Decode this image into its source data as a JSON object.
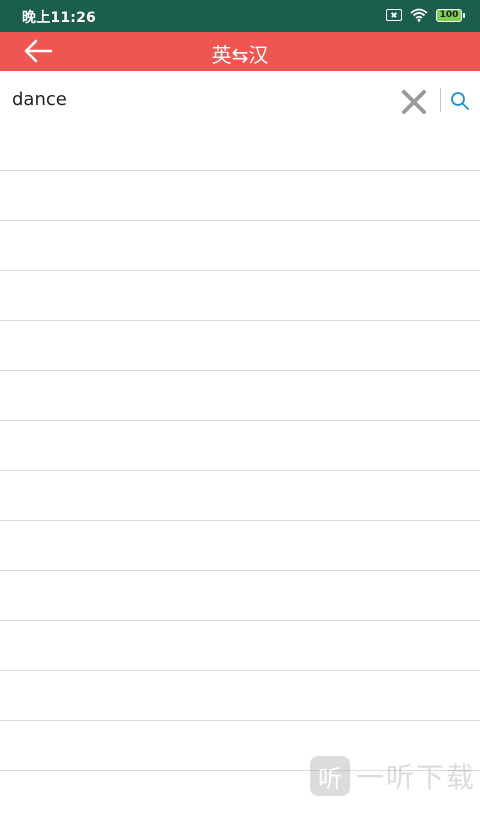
{
  "status_bar": {
    "time": "晚上11:26",
    "battery": "100",
    "icons": [
      "sim-x-icon",
      "wifi-icon",
      "battery-icon"
    ]
  },
  "app_bar": {
    "title": "英⇆汉",
    "back_icon": "arrow-left-icon",
    "background": "#ef5551"
  },
  "search": {
    "value": "dance",
    "clear_icon": "close-icon",
    "search_icon": "search-icon",
    "accent": "#1d8fd1"
  },
  "results": {
    "rows": [
      "",
      "",
      "",
      "",
      "",
      "",
      "",
      "",
      "",
      "",
      "",
      "",
      ""
    ]
  },
  "watermark": {
    "text": "一听下载",
    "logo_char": "听"
  }
}
